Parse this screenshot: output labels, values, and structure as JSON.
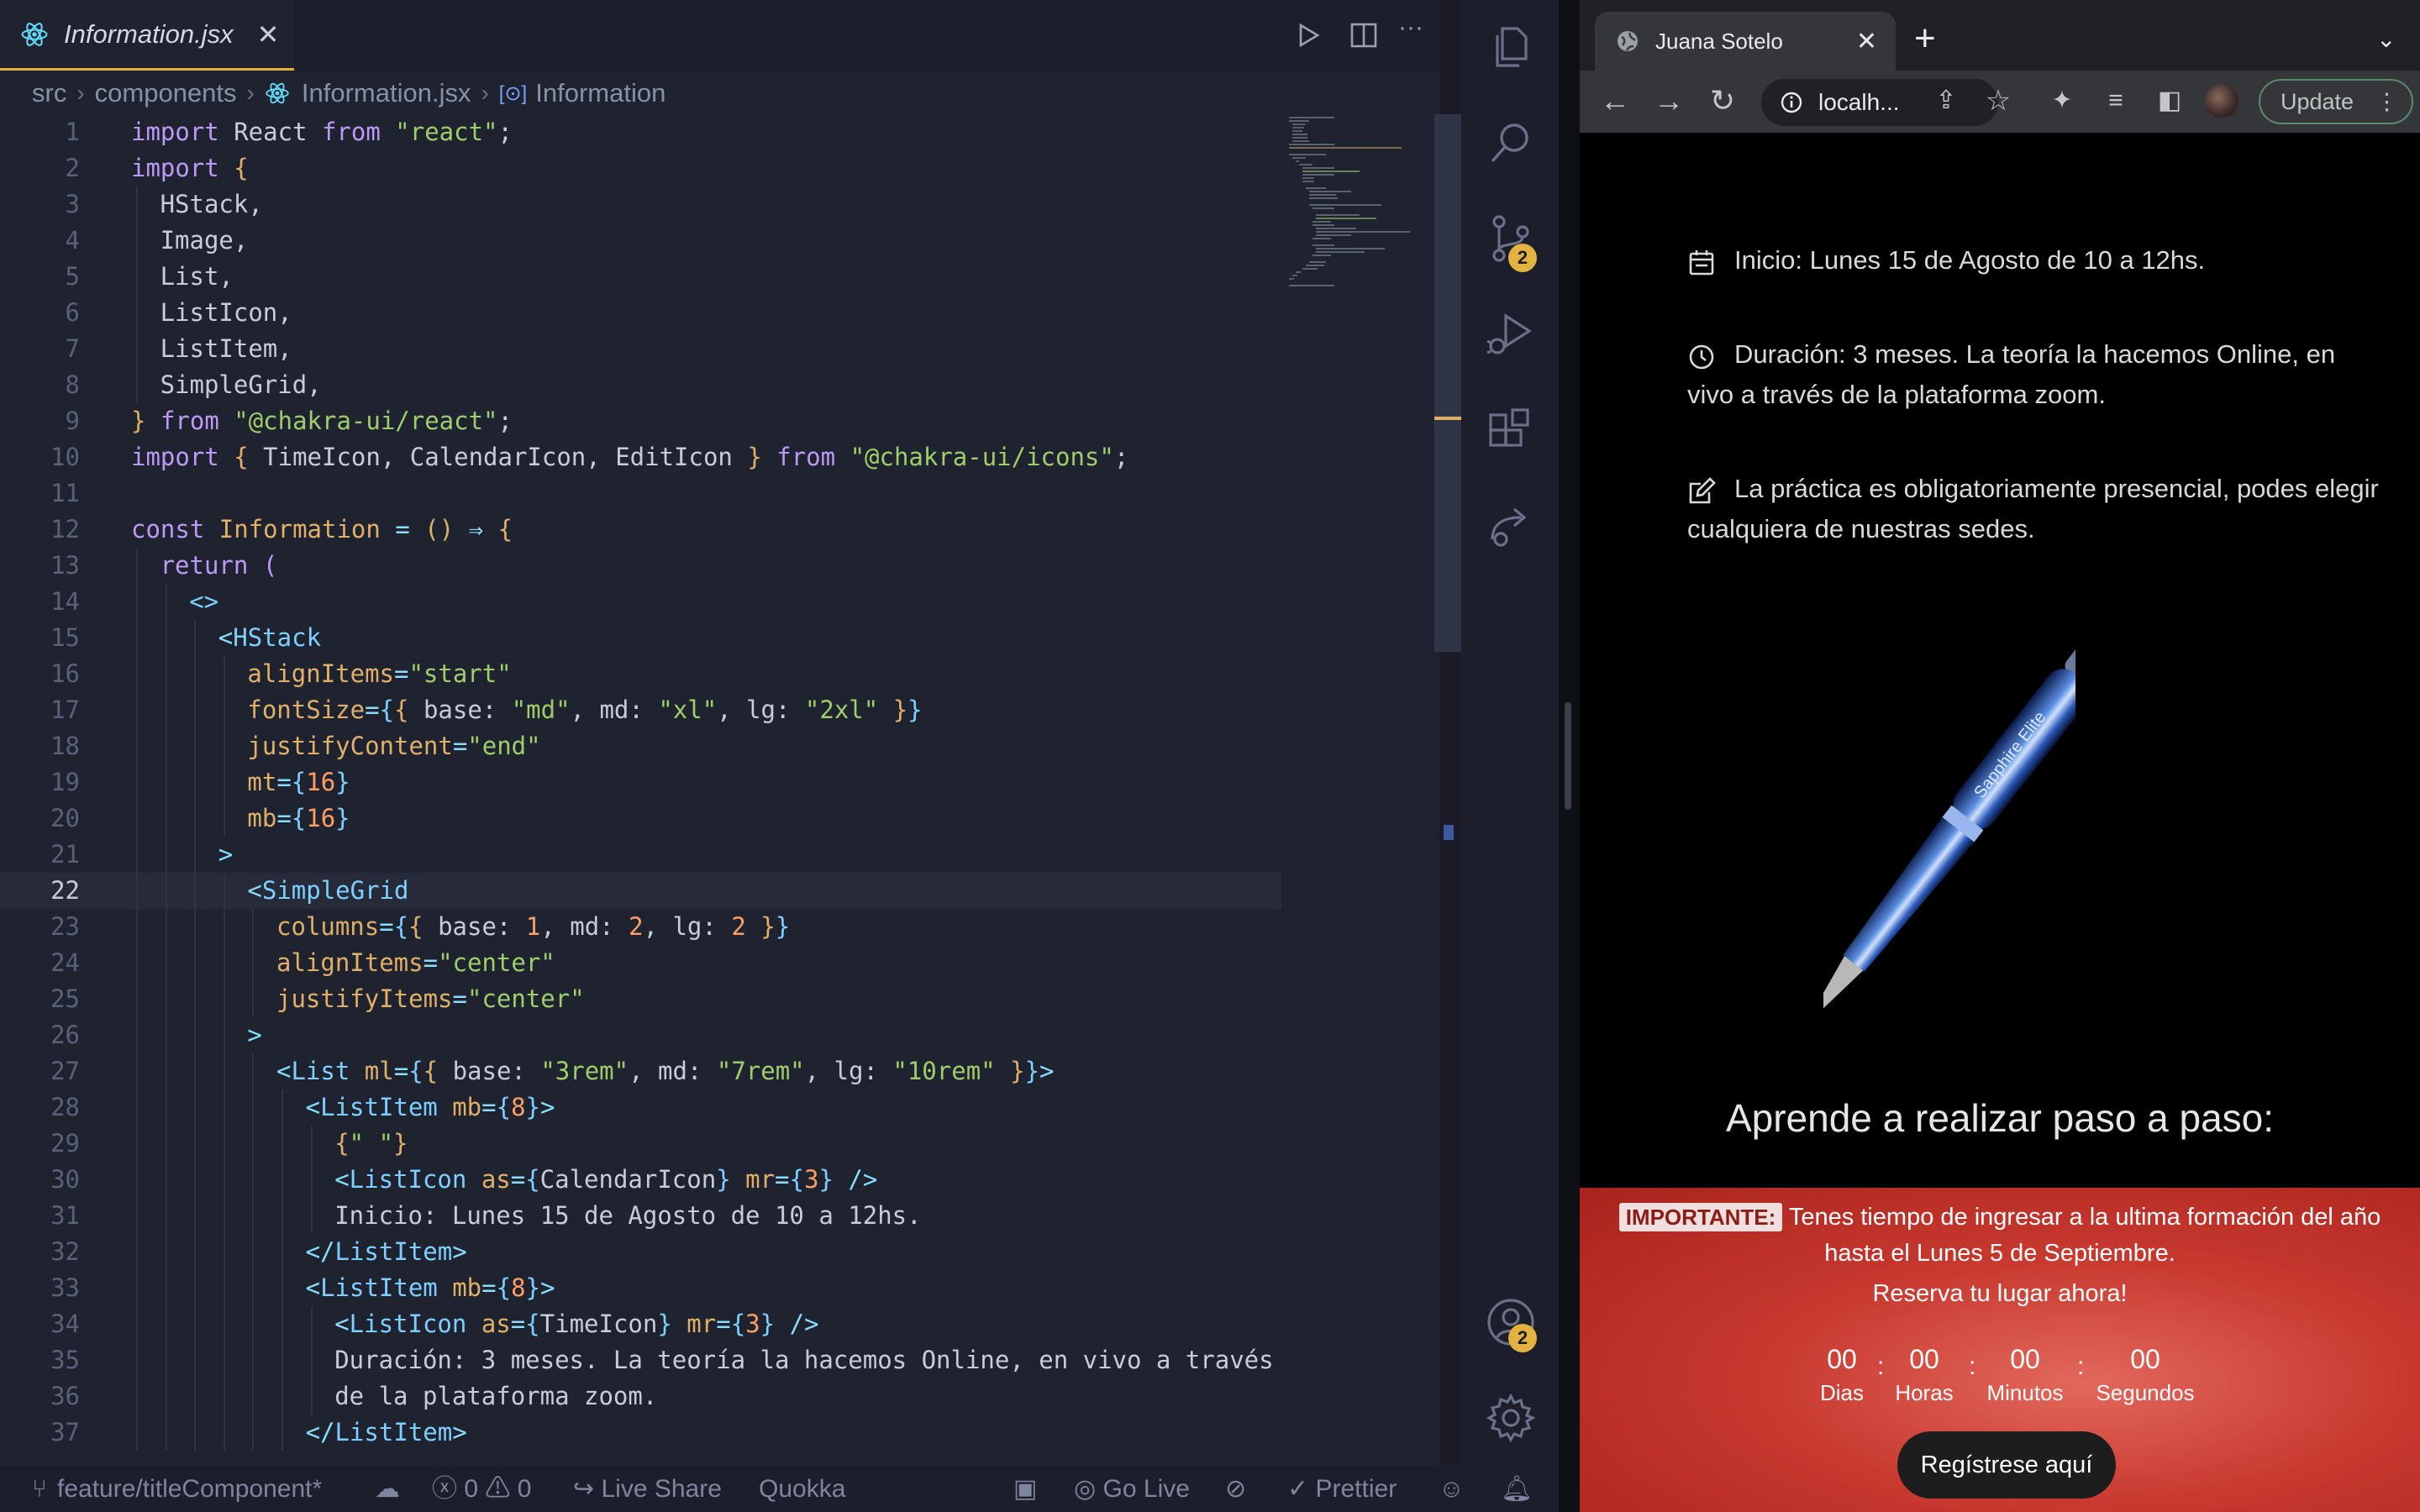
{
  "editor": {
    "tab_title": "Information.jsx",
    "breadcrumbs": [
      "src",
      "components",
      "Information.jsx",
      "Information"
    ],
    "current_line": 22,
    "lines": [
      {
        "n": 1,
        "indent": 0,
        "parts": [
          [
            "kw",
            "import"
          ],
          [
            "txt",
            " React "
          ],
          [
            "kw",
            "from"
          ],
          [
            "txt",
            " "
          ],
          [
            "str",
            "\"react\""
          ],
          [
            "txt",
            ";"
          ]
        ]
      },
      {
        "n": 2,
        "indent": 0,
        "parts": [
          [
            "kw",
            "import"
          ],
          [
            "txt",
            " "
          ],
          [
            "br",
            "{"
          ]
        ]
      },
      {
        "n": 3,
        "indent": 1,
        "parts": [
          [
            "txt",
            "HStack,"
          ]
        ]
      },
      {
        "n": 4,
        "indent": 1,
        "parts": [
          [
            "txt",
            "Image,"
          ]
        ]
      },
      {
        "n": 5,
        "indent": 1,
        "parts": [
          [
            "txt",
            "List,"
          ]
        ]
      },
      {
        "n": 6,
        "indent": 1,
        "parts": [
          [
            "txt",
            "ListIcon,"
          ]
        ]
      },
      {
        "n": 7,
        "indent": 1,
        "parts": [
          [
            "txt",
            "ListItem,"
          ]
        ]
      },
      {
        "n": 8,
        "indent": 1,
        "parts": [
          [
            "txt",
            "SimpleGrid,"
          ]
        ]
      },
      {
        "n": 9,
        "indent": 0,
        "parts": [
          [
            "br",
            "}"
          ],
          [
            "txt",
            " "
          ],
          [
            "kw",
            "from"
          ],
          [
            "txt",
            " "
          ],
          [
            "str",
            "\"@chakra-ui/react\""
          ],
          [
            "txt",
            ";"
          ]
        ]
      },
      {
        "n": 10,
        "indent": 0,
        "parts": [
          [
            "kw",
            "import"
          ],
          [
            "txt",
            " "
          ],
          [
            "br",
            "{"
          ],
          [
            "txt",
            " TimeIcon, CalendarIcon, EditIcon "
          ],
          [
            "br",
            "}"
          ],
          [
            "txt",
            " "
          ],
          [
            "kw",
            "from"
          ],
          [
            "txt",
            " "
          ],
          [
            "str",
            "\"@chakra-ui/icons\""
          ],
          [
            "txt",
            ";"
          ]
        ]
      },
      {
        "n": 11,
        "indent": 0,
        "parts": []
      },
      {
        "n": 12,
        "indent": 0,
        "parts": [
          [
            "kw",
            "const"
          ],
          [
            "txt",
            " "
          ],
          [
            "kw2",
            "Information"
          ],
          [
            "txt",
            " "
          ],
          [
            "pun",
            "="
          ],
          [
            "txt",
            " "
          ],
          [
            "br",
            "()"
          ],
          [
            "txt",
            " "
          ],
          [
            "pun",
            "⇒"
          ],
          [
            "txt",
            " "
          ],
          [
            "br",
            "{"
          ]
        ]
      },
      {
        "n": 13,
        "indent": 1,
        "parts": [
          [
            "kw",
            "return"
          ],
          [
            "txt",
            " "
          ],
          [
            "kw",
            "("
          ]
        ]
      },
      {
        "n": 14,
        "indent": 2,
        "parts": [
          [
            "tag",
            "<>"
          ]
        ]
      },
      {
        "n": 15,
        "indent": 3,
        "parts": [
          [
            "pun",
            "<"
          ],
          [
            "tag",
            "HStack"
          ]
        ]
      },
      {
        "n": 16,
        "indent": 4,
        "parts": [
          [
            "attr",
            "alignItems"
          ],
          [
            "pun",
            "="
          ],
          [
            "str",
            "\"start\""
          ]
        ]
      },
      {
        "n": 17,
        "indent": 4,
        "parts": [
          [
            "attr",
            "fontSize"
          ],
          [
            "pun",
            "="
          ],
          [
            "tag",
            "{"
          ],
          [
            "br",
            "{"
          ],
          [
            "txt",
            " base: "
          ],
          [
            "str",
            "\"md\""
          ],
          [
            "txt",
            ", md: "
          ],
          [
            "str",
            "\"xl\""
          ],
          [
            "txt",
            ", lg: "
          ],
          [
            "str",
            "\"2xl\""
          ],
          [
            "txt",
            " "
          ],
          [
            "br",
            "}"
          ],
          [
            "tag",
            "}"
          ]
        ]
      },
      {
        "n": 18,
        "indent": 4,
        "parts": [
          [
            "attr",
            "justifyContent"
          ],
          [
            "pun",
            "="
          ],
          [
            "str",
            "\"end\""
          ]
        ]
      },
      {
        "n": 19,
        "indent": 4,
        "parts": [
          [
            "attr",
            "mt"
          ],
          [
            "pun",
            "="
          ],
          [
            "tag",
            "{"
          ],
          [
            "num",
            "16"
          ],
          [
            "tag",
            "}"
          ]
        ]
      },
      {
        "n": 20,
        "indent": 4,
        "parts": [
          [
            "attr",
            "mb"
          ],
          [
            "pun",
            "="
          ],
          [
            "tag",
            "{"
          ],
          [
            "num",
            "16"
          ],
          [
            "tag",
            "}"
          ]
        ]
      },
      {
        "n": 21,
        "indent": 3,
        "parts": [
          [
            "pun",
            ">"
          ]
        ]
      },
      {
        "n": 22,
        "indent": 4,
        "parts": [
          [
            "pun",
            "<"
          ],
          [
            "tag",
            "SimpleGrid"
          ]
        ]
      },
      {
        "n": 23,
        "indent": 5,
        "parts": [
          [
            "attr",
            "columns"
          ],
          [
            "pun",
            "="
          ],
          [
            "tag",
            "{"
          ],
          [
            "br",
            "{"
          ],
          [
            "txt",
            " base: "
          ],
          [
            "num",
            "1"
          ],
          [
            "txt",
            ", md: "
          ],
          [
            "num",
            "2"
          ],
          [
            "txt",
            ", lg: "
          ],
          [
            "num",
            "2"
          ],
          [
            "txt",
            " "
          ],
          [
            "br",
            "}"
          ],
          [
            "tag",
            "}"
          ]
        ]
      },
      {
        "n": 24,
        "indent": 5,
        "parts": [
          [
            "attr",
            "alignItems"
          ],
          [
            "pun",
            "="
          ],
          [
            "str",
            "\"center\""
          ]
        ]
      },
      {
        "n": 25,
        "indent": 5,
        "parts": [
          [
            "attr",
            "justifyItems"
          ],
          [
            "pun",
            "="
          ],
          [
            "str",
            "\"center\""
          ]
        ]
      },
      {
        "n": 26,
        "indent": 4,
        "parts": [
          [
            "pun",
            ">"
          ]
        ]
      },
      {
        "n": 27,
        "indent": 5,
        "parts": [
          [
            "pun",
            "<"
          ],
          [
            "tag",
            "List"
          ],
          [
            "txt",
            " "
          ],
          [
            "attr",
            "ml"
          ],
          [
            "pun",
            "="
          ],
          [
            "tag",
            "{"
          ],
          [
            "br",
            "{"
          ],
          [
            "txt",
            " base: "
          ],
          [
            "str",
            "\"3rem\""
          ],
          [
            "txt",
            ", md: "
          ],
          [
            "str",
            "\"7rem\""
          ],
          [
            "txt",
            ", lg: "
          ],
          [
            "str",
            "\"10rem\""
          ],
          [
            "txt",
            " "
          ],
          [
            "br",
            "}"
          ],
          [
            "tag",
            "}"
          ],
          [
            "pun",
            ">"
          ]
        ]
      },
      {
        "n": 28,
        "indent": 6,
        "parts": [
          [
            "pun",
            "<"
          ],
          [
            "tag",
            "ListItem"
          ],
          [
            "txt",
            " "
          ],
          [
            "attr",
            "mb"
          ],
          [
            "pun",
            "="
          ],
          [
            "tag",
            "{"
          ],
          [
            "num",
            "8"
          ],
          [
            "tag",
            "}"
          ],
          [
            "pun",
            ">"
          ]
        ]
      },
      {
        "n": 29,
        "indent": 7,
        "parts": [
          [
            "br",
            "{"
          ],
          [
            "str",
            "\" \""
          ],
          [
            "br",
            "}"
          ]
        ]
      },
      {
        "n": 30,
        "indent": 7,
        "parts": [
          [
            "pun",
            "<"
          ],
          [
            "tag",
            "ListIcon"
          ],
          [
            "txt",
            " "
          ],
          [
            "attr",
            "as"
          ],
          [
            "pun",
            "="
          ],
          [
            "tag",
            "{"
          ],
          [
            "txt",
            "CalendarIcon"
          ],
          [
            "tag",
            "}"
          ],
          [
            "txt",
            " "
          ],
          [
            "attr",
            "mr"
          ],
          [
            "pun",
            "="
          ],
          [
            "tag",
            "{"
          ],
          [
            "num",
            "3"
          ],
          [
            "tag",
            "}"
          ],
          [
            "txt",
            " "
          ],
          [
            "pun",
            "/>"
          ]
        ]
      },
      {
        "n": 31,
        "indent": 7,
        "parts": [
          [
            "txt",
            "Inicio: Lunes 15 de Agosto de 10 a 12hs."
          ]
        ]
      },
      {
        "n": 32,
        "indent": 6,
        "parts": [
          [
            "pun",
            "</"
          ],
          [
            "tag",
            "ListItem"
          ],
          [
            "pun",
            ">"
          ]
        ]
      },
      {
        "n": 33,
        "indent": 6,
        "parts": [
          [
            "pun",
            "<"
          ],
          [
            "tag",
            "ListItem"
          ],
          [
            "txt",
            " "
          ],
          [
            "attr",
            "mb"
          ],
          [
            "pun",
            "="
          ],
          [
            "tag",
            "{"
          ],
          [
            "num",
            "8"
          ],
          [
            "tag",
            "}"
          ],
          [
            "pun",
            ">"
          ]
        ]
      },
      {
        "n": 34,
        "indent": 7,
        "parts": [
          [
            "pun",
            "<"
          ],
          [
            "tag",
            "ListIcon"
          ],
          [
            "txt",
            " "
          ],
          [
            "attr",
            "as"
          ],
          [
            "pun",
            "="
          ],
          [
            "tag",
            "{"
          ],
          [
            "txt",
            "TimeIcon"
          ],
          [
            "tag",
            "}"
          ],
          [
            "txt",
            " "
          ],
          [
            "attr",
            "mr"
          ],
          [
            "pun",
            "="
          ],
          [
            "tag",
            "{"
          ],
          [
            "num",
            "3"
          ],
          [
            "tag",
            "}"
          ],
          [
            "txt",
            " "
          ],
          [
            "pun",
            "/>"
          ]
        ]
      },
      {
        "n": 35,
        "indent": 7,
        "parts": [
          [
            "txt",
            "Duración: 3 meses. La teoría la hacemos Online, en vivo a través"
          ]
        ]
      },
      {
        "n": 36,
        "indent": 7,
        "parts": [
          [
            "txt",
            "de la plataforma zoom."
          ]
        ]
      },
      {
        "n": 37,
        "indent": 6,
        "parts": [
          [
            "pun",
            "</"
          ],
          [
            "tag",
            "ListItem"
          ],
          [
            "pun",
            ">"
          ]
        ]
      }
    ]
  },
  "activity_bar": {
    "source_control_badge": "2",
    "accounts_badge": "2"
  },
  "statusbar": {
    "branch": "feature/titleComponent*",
    "errors": "0",
    "warnings": "0",
    "live_share": "Live Share",
    "quokka": "Quokka",
    "go_live": "Go Live",
    "prettier": "Prettier"
  },
  "browser": {
    "tab_title": "Juana Sotelo",
    "url": "localh...",
    "update_label": "Update",
    "info": [
      {
        "icon": "calendar-icon",
        "text": "Inicio: Lunes 15 de Agosto de 10 a 12hs."
      },
      {
        "icon": "clock-icon",
        "text": "Duración: 3 meses. La teoría la hacemos Online, en vivo a través de la plataforma zoom."
      },
      {
        "icon": "edit-icon",
        "text": "La práctica es obligatoriamente presencial, podes elegir cualquiera de nuestras sedes."
      }
    ],
    "pen_brand": "Sapphire Elite",
    "learn_title": "Aprende a realizar paso a paso:",
    "promo": {
      "badge": "IMPORTANTE:",
      "text": "Tenes tiempo de ingresar a la ultima formación del año hasta el Lunes 5 de Septiembre.",
      "reserve": "Reserva tu lugar ahora!",
      "countdown": [
        {
          "value": "00",
          "label": "Dias"
        },
        {
          "value": "00",
          "label": "Horas"
        },
        {
          "value": "00",
          "label": "Minutos"
        },
        {
          "value": "00",
          "label": "Segundos"
        }
      ],
      "cta": "Regístrese aquí"
    }
  },
  "colors": {
    "accent": "#e3b341",
    "editor_bg": "#1f2330",
    "promo_red": "#c8392f"
  }
}
